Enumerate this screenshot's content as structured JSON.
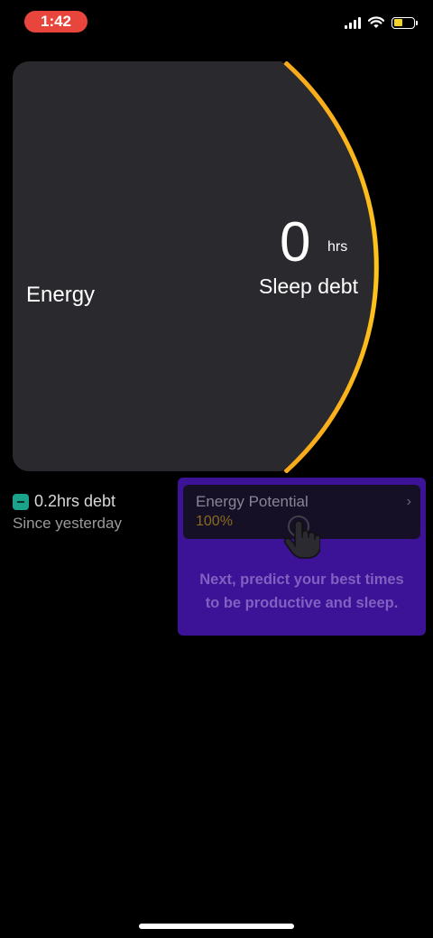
{
  "status_bar": {
    "time": "1:42",
    "signal_icon": "cellular-signal-icon",
    "wifi_icon": "wifi-icon",
    "battery_icon": "battery-low-icon",
    "battery_level": 0.45
  },
  "energy_card": {
    "energy_label": "Energy",
    "sleep_debt_value": "0",
    "sleep_debt_unit": "hrs",
    "sleep_debt_label": "Sleep debt",
    "card_color": "#2a292e",
    "arc_gradient": [
      "#f7a91c",
      "#ffc61a"
    ]
  },
  "debt_stat": {
    "badge_icon": "minus-icon",
    "value": "0.2hrs debt",
    "since": "Since yesterday",
    "badge_color": "#1aa38a"
  },
  "tooltip": {
    "background": "#3c1296",
    "potential_card": {
      "title": "Energy Potential",
      "value": "100%",
      "chevron_icon": "chevron-right-icon"
    },
    "hand_icon": "tap-hand-icon",
    "message_line1": "Next, predict your best times",
    "message_line2": "to be productive and sleep."
  }
}
